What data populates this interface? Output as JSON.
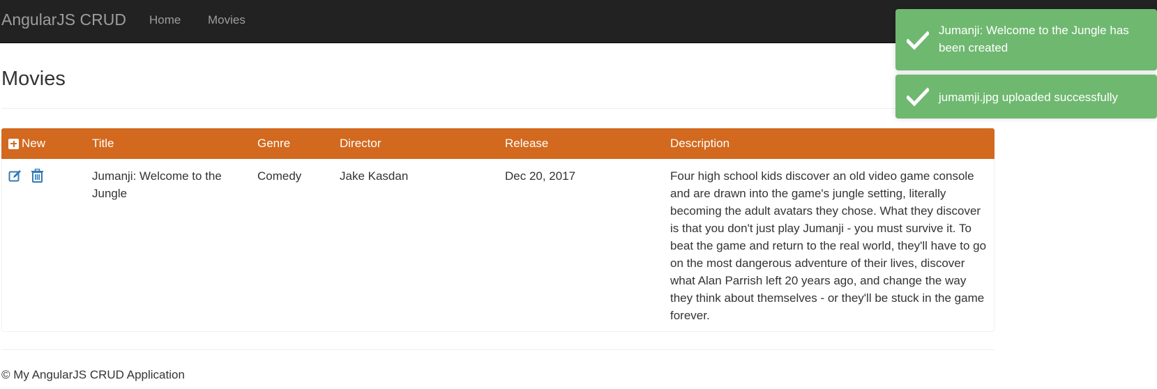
{
  "navbar": {
    "brand": "AngularJS CRUD",
    "links": [
      {
        "label": "Home"
      },
      {
        "label": "Movies"
      }
    ]
  },
  "page": {
    "title": "Movies"
  },
  "table": {
    "new_label": "New",
    "headers": [
      "Title",
      "Genre",
      "Director",
      "Release",
      "Description"
    ],
    "rows": [
      {
        "title": "Jumanji: Welcome to the Jungle",
        "genre": "Comedy",
        "director": "Jake Kasdan",
        "release": "Dec 20, 2017",
        "description": "Four high school kids discover an old video game console and are drawn into the game's jungle setting, literally becoming the adult avatars they chose. What they discover is that you don't just play Jumanji - you must survive it. To beat the game and return to the real world, they'll have to go on the most dangerous adventure of their lives, discover what Alan Parrish left 20 years ago, and change the way they think about themselves - or they'll be stuck in the game forever."
      }
    ],
    "icons": {
      "edit": "edit-icon",
      "delete": "trash-icon",
      "new": "plus-square-icon"
    }
  },
  "footer": {
    "text": "© My AngularJS CRUD Application"
  },
  "toasts": [
    {
      "message": "Jumanji: Welcome to the Jungle has been created",
      "icon": "checkmark-icon"
    },
    {
      "message": "jumamji.jpg uploaded successfully",
      "icon": "checkmark-icon"
    }
  ],
  "colors": {
    "navbar_bg": "#222222",
    "table_header_bg": "#d2691e",
    "toast_bg": "#6fb870",
    "link_icon": "#337ab7"
  }
}
